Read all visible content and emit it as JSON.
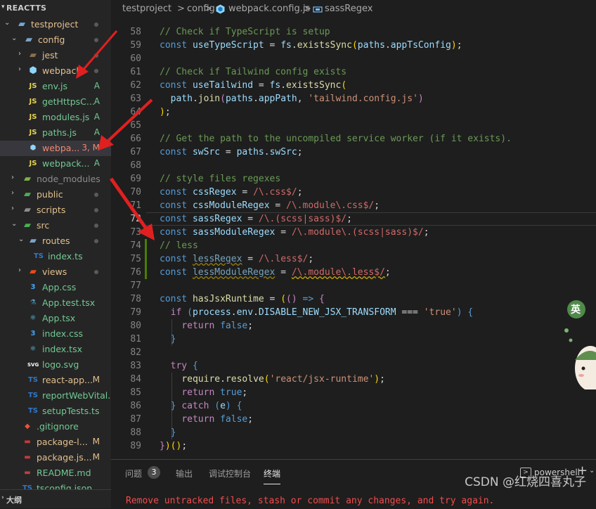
{
  "explorer": {
    "root_label": "REACTTS",
    "items": [
      {
        "label": "testproject",
        "badge": "",
        "dot": true
      },
      {
        "label": "config",
        "badge": "",
        "dot": true
      },
      {
        "label": "jest",
        "badge": "",
        "dot": true
      },
      {
        "label": "webpack",
        "badge": "",
        "dot": true
      },
      {
        "label": "env.js",
        "badge": "A",
        "dot": false
      },
      {
        "label": "getHttpsC...",
        "badge": "A",
        "dot": false
      },
      {
        "label": "modules.js",
        "badge": "A",
        "dot": false
      },
      {
        "label": "paths.js",
        "badge": "A",
        "dot": false
      },
      {
        "label": "webpa...",
        "badge": "3, M",
        "dot": false
      },
      {
        "label": "webpack...",
        "badge": "A",
        "dot": false
      },
      {
        "label": "node_modules",
        "badge": "",
        "dot": false
      },
      {
        "label": "public",
        "badge": "",
        "dot": true
      },
      {
        "label": "scripts",
        "badge": "",
        "dot": true
      },
      {
        "label": "src",
        "badge": "",
        "dot": true
      },
      {
        "label": "routes",
        "badge": "",
        "dot": true
      },
      {
        "label": "index.ts",
        "badge": "",
        "dot": false
      },
      {
        "label": "views",
        "badge": "",
        "dot": true
      },
      {
        "label": "App.css",
        "badge": "",
        "dot": false
      },
      {
        "label": "App.test.tsx",
        "badge": "",
        "dot": false
      },
      {
        "label": "App.tsx",
        "badge": "",
        "dot": false
      },
      {
        "label": "index.css",
        "badge": "",
        "dot": false
      },
      {
        "label": "index.tsx",
        "badge": "",
        "dot": false
      },
      {
        "label": "logo.svg",
        "badge": "",
        "dot": false
      },
      {
        "label": "react-app...",
        "badge": "M",
        "dot": false
      },
      {
        "label": "reportWebVital...",
        "badge": "",
        "dot": false
      },
      {
        "label": "setupTests.ts",
        "badge": "",
        "dot": false
      },
      {
        "label": ".gitignore",
        "badge": "",
        "dot": false
      },
      {
        "label": "package-l...",
        "badge": "M",
        "dot": false
      },
      {
        "label": "package.js...",
        "badge": "M",
        "dot": false
      },
      {
        "label": "README.md",
        "badge": "",
        "dot": false
      },
      {
        "label": "tsconfig.json",
        "badge": "",
        "dot": false
      }
    ],
    "outline_label": "大纲"
  },
  "breadcrumb": {
    "parts": [
      "testproject",
      "config",
      "webpack.config.js",
      "sassRegex"
    ],
    "separator": ">"
  },
  "editor": {
    "line_numbers": [
      "58",
      "59",
      "60",
      "61",
      "62",
      "63",
      "64",
      "65",
      "66",
      "67",
      "68",
      "69",
      "70",
      "71",
      "72",
      "73",
      "74",
      "75",
      "76",
      "77",
      "78",
      "79",
      "80",
      "81",
      "82",
      "83",
      "84",
      "85",
      "86",
      "87",
      "88",
      "89"
    ],
    "tokens": {
      "l58_comment": "// Check if TypeScript is setup",
      "const": "const",
      "l59_name": "useTypeScript",
      "eq": " = ",
      "fs": "fs",
      "dot": ".",
      "existsSync": "existsSync",
      "paths": "paths",
      "appTsConfig": "appTsConfig",
      "l61_comment": "// Check if Tailwind config exists",
      "l62_name": "useTailwind",
      "path": "path",
      "join": "join",
      "appPath": "appPath",
      "tailwind_str": "'tailwind.config.js'",
      "l66_comment": "// Get the path to the uncompiled service worker (if it exists).",
      "swSrc": "swSrc",
      "l69_comment": "// style files regexes",
      "cssRegex": "cssRegex",
      "cssModuleRegex": "cssModuleRegex",
      "sassRegex": "sassRegex",
      "sassModuleRegex": "sassModuleRegex",
      "l74_comment": "// less",
      "lessRegex": "lessRegex",
      "lessModuleRegex": "lessModuleRegex",
      "rx_css": "/\\.css$/",
      "rx_module_css": "/\\.module\\.css$/",
      "rx_sass": "/\\.(scss|sass)$/",
      "rx_module_sass": "/\\.module\\.(scss|sass)$/",
      "rx_less": "/\\.less$/",
      "rx_module_less": "/\\.module\\.less$/",
      "hasJsxRuntime": "hasJsxRuntime",
      "arrow": "=>",
      "if": "if",
      "process": "process",
      "env": "env",
      "disable_flag": "DISABLE_NEW_JSX_TRANSFORM",
      "triple_eq": " === ",
      "true_str": "'true'",
      "return": "return",
      "false": "false",
      "true": "true",
      "try": "try",
      "require": "require",
      "resolve": "resolve",
      "jsx_runtime_str": "'react/jsx-runtime'",
      "catch": "catch",
      "e": "e"
    }
  },
  "panel": {
    "tabs": [
      {
        "label": "问题",
        "badge": "3"
      },
      {
        "label": "输出"
      },
      {
        "label": "调试控制台"
      },
      {
        "label": "终端"
      }
    ],
    "active_tab": "终端",
    "terminal_profile": "powershell",
    "terminal_text": "Remove untracked files, stash or commit any changes, and try again."
  },
  "watermark": "CSDN @红烧四喜丸子",
  "colors": {
    "comment": "#6a9955",
    "keyword": "#569cd6",
    "variable": "#9cdcfe",
    "function": "#dcdcaa",
    "string": "#ce9178",
    "regex": "#d16969",
    "added_badge": "#73c991",
    "modified_badge": "#e2c08d",
    "error_text": "#f14c4c",
    "annotation_arrow": "#e02020"
  }
}
